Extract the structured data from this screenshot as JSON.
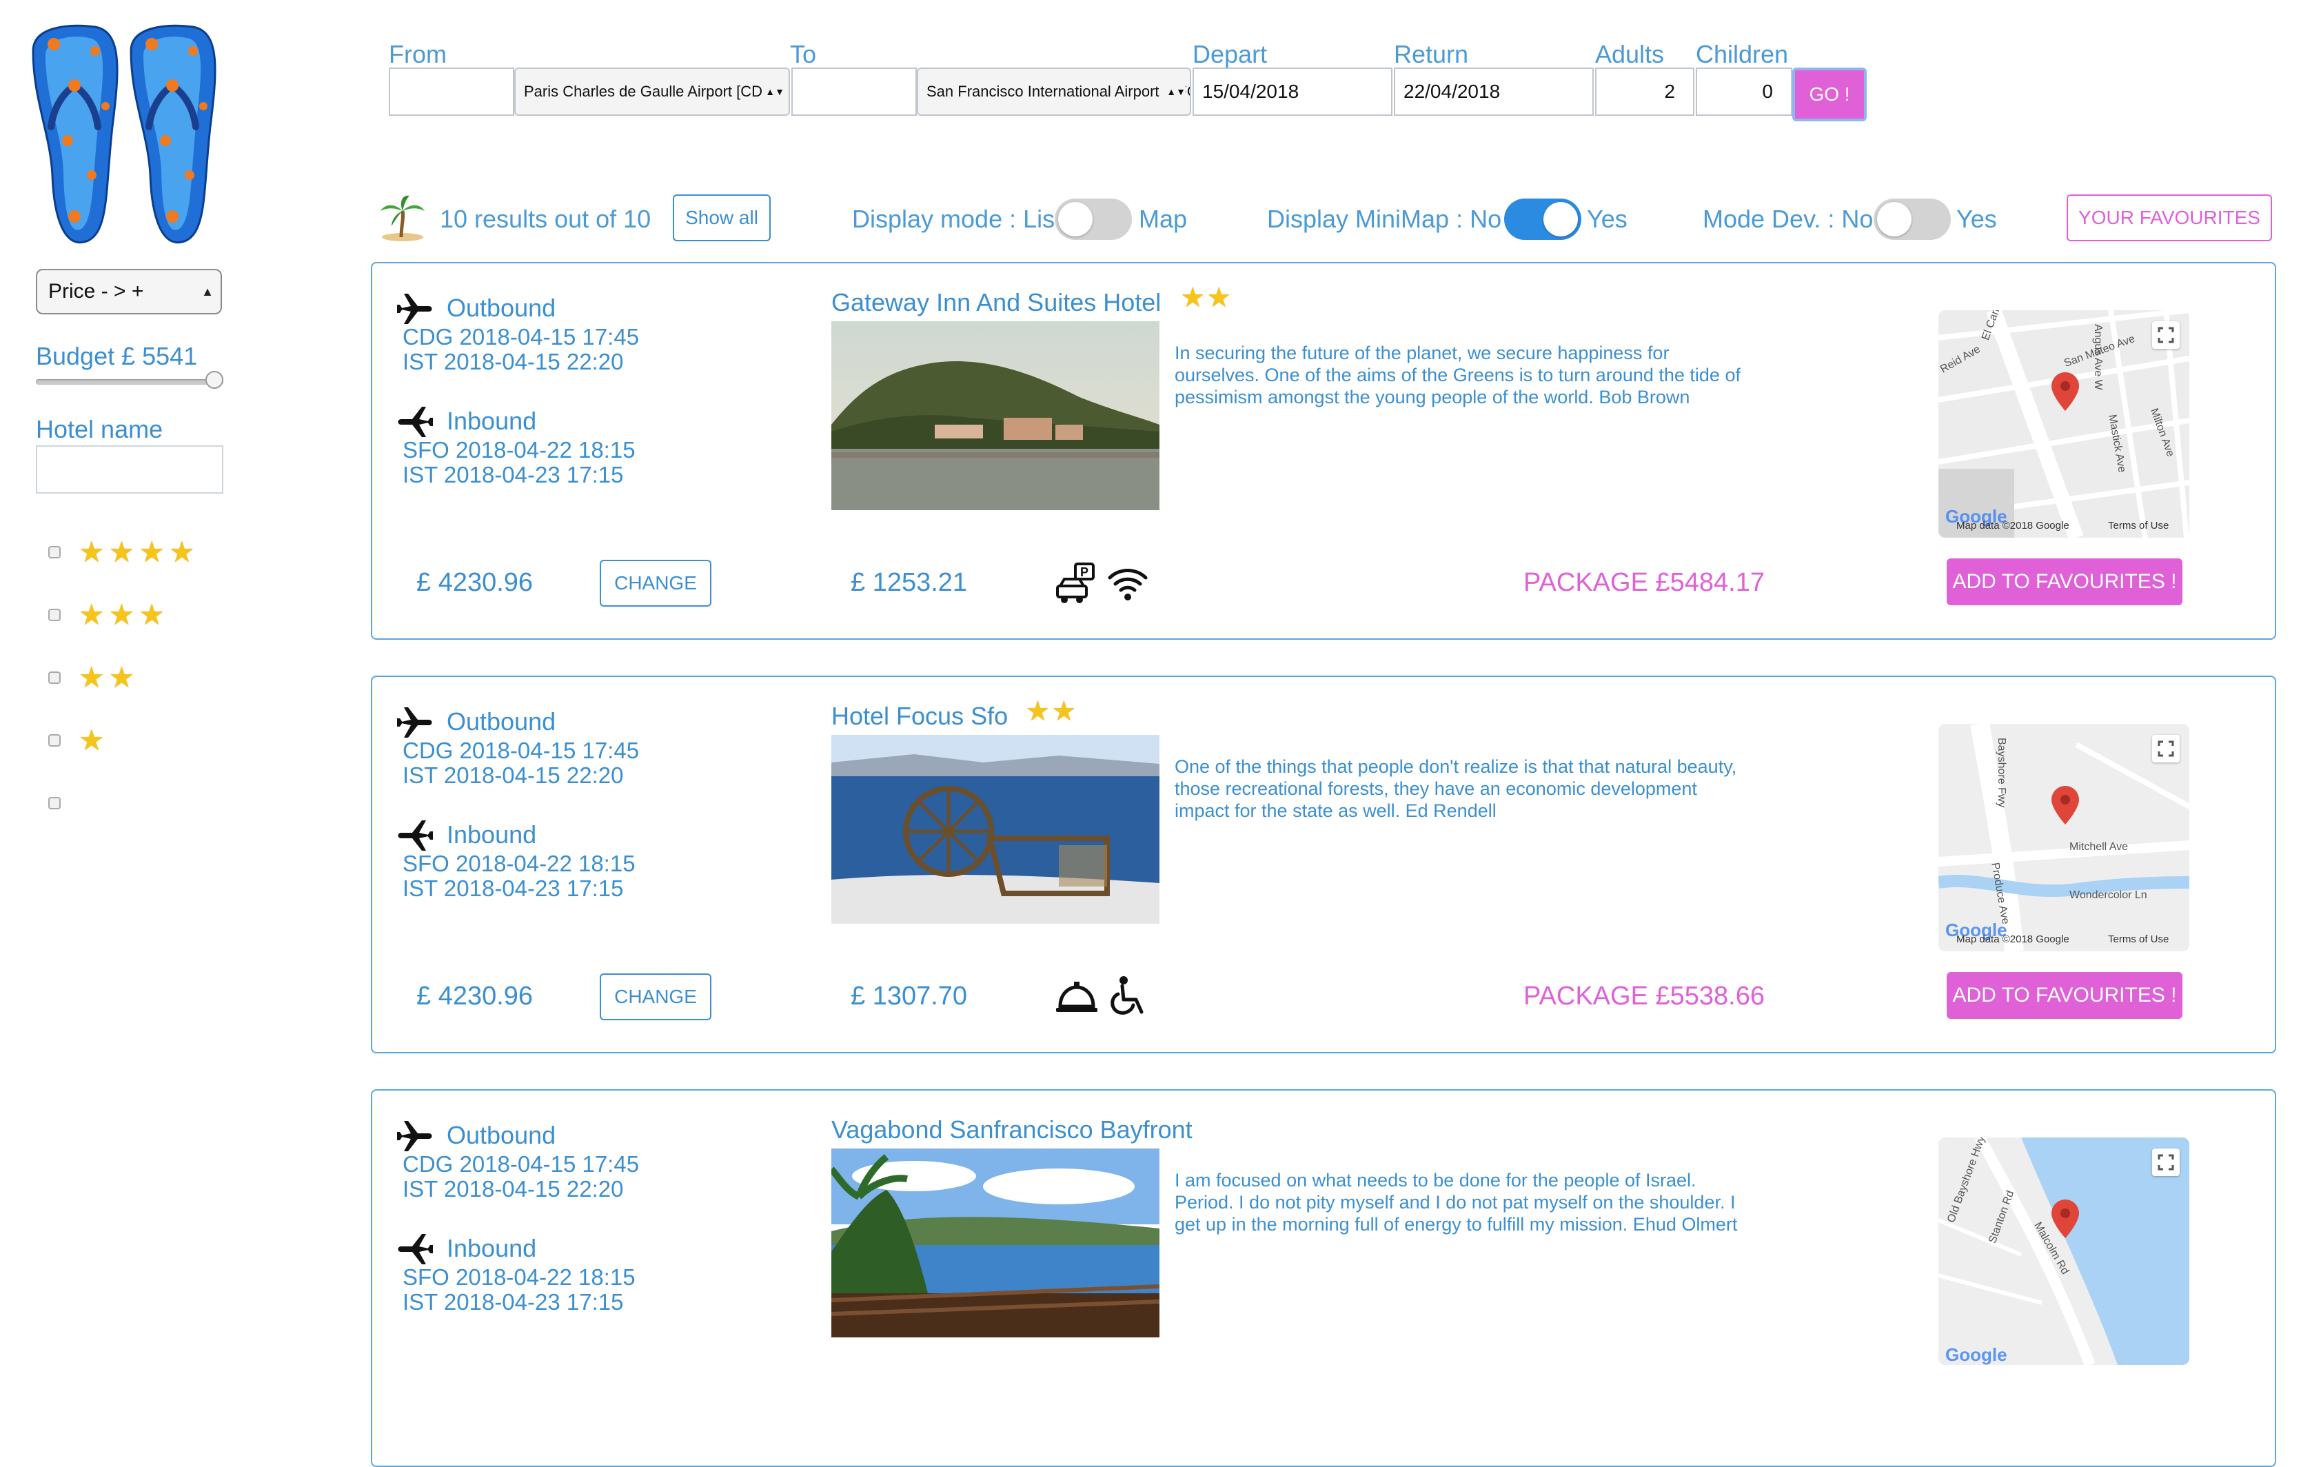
{
  "sidebar": {
    "sort_label": "Price - > +",
    "budget_label": "Budget £ 5541",
    "budget_fill": 1.0,
    "hotel_name_label": "Hotel name",
    "hotel_name_value": "",
    "star_filters": [
      {
        "stars": 4,
        "checked": false
      },
      {
        "stars": 3,
        "checked": false
      },
      {
        "stars": 2,
        "checked": false
      },
      {
        "stars": 1,
        "checked": false
      },
      {
        "stars": 0,
        "checked": false
      }
    ]
  },
  "search": {
    "from_label": "From",
    "from_value": "",
    "from_airport": "Paris Charles de Gaulle Airport [CDG]",
    "to_label": "To",
    "to_value": "",
    "to_airport": "San Francisco International Airport [SFO]",
    "depart_label": "Depart",
    "depart_value": "15/04/2018",
    "return_label": "Return",
    "return_value": "22/04/2018",
    "adults_label": "Adults",
    "adults_value": "2",
    "children_label": "Children",
    "children_value": "0",
    "go_label": "GO !"
  },
  "toolbar": {
    "results_text": "10 results out of 10",
    "show_all_label": "Show all",
    "display_mode_label": "Display mode : List",
    "display_mode_alt": "Map",
    "display_mode_on": false,
    "minimap_label": "Display MiniMap : No",
    "minimap_alt": "Yes",
    "minimap_on": true,
    "mode_dev_label": "Mode Dev. : No",
    "mode_dev_alt": "Yes",
    "mode_dev_on": false,
    "favourites_label": "YOUR FAVOURITES"
  },
  "results": [
    {
      "outbound_label": "Outbound",
      "outbound_dep": "CDG 2018-04-15 17:45",
      "outbound_arr": "IST 2018-04-15 22:20",
      "inbound_label": "Inbound",
      "inbound_dep": "SFO 2018-04-22 18:15",
      "inbound_arr": "IST 2018-04-23 17:15",
      "flight_price": "£ 4230.96",
      "change_label": "CHANGE",
      "hotel_name": "Gateway Inn And Suites Hotel",
      "hotel_stars": 2,
      "description": "In securing the future of the planet, we secure happiness for ourselves. One of the aims of the Greens is to turn around the tide of pessimism amongst the young people of the world. Bob Brown",
      "hotel_price": "£ 1253.21",
      "amenities": [
        "parking-icon",
        "wifi-icon"
      ],
      "package_label": "PACKAGE £5484.17",
      "add_fav_label": "ADD TO FAVOURITES !",
      "map_labels": [
        "El Camino Real",
        "San Mateo Ave",
        "Angus Ave W",
        "Reid Ave",
        "Mastick Ave",
        "Milton Ave"
      ],
      "map_footer": "Map data ©2018 Google",
      "map_terms": "Terms of Use"
    },
    {
      "outbound_label": "Outbound",
      "outbound_dep": "CDG 2018-04-15 17:45",
      "outbound_arr": "IST 2018-04-15 22:20",
      "inbound_label": "Inbound",
      "inbound_dep": "SFO 2018-04-22 18:15",
      "inbound_arr": "IST 2018-04-23 17:15",
      "flight_price": "£ 4230.96",
      "change_label": "CHANGE",
      "hotel_name": "Hotel Focus Sfo",
      "hotel_stars": 2,
      "description": "One of the things that people don't realize is that that natural beauty, those recreational forests, they have an economic development impact for the state as well. Ed Rendell",
      "hotel_price": "£ 1307.70",
      "amenities": [
        "room-service-icon",
        "wheelchair-icon"
      ],
      "package_label": "PACKAGE £5538.66",
      "add_fav_label": "ADD TO FAVOURITES !",
      "map_labels": [
        "Bayshore Fwy",
        "Mitchell Ave",
        "Produce Ave",
        "Wondercolor Ln"
      ],
      "map_footer": "Map data ©2018 Google",
      "map_terms": "Terms of Use"
    },
    {
      "outbound_label": "Outbound",
      "outbound_dep": "CDG 2018-04-15 17:45",
      "outbound_arr": "IST 2018-04-15 22:20",
      "inbound_label": "Inbound",
      "inbound_dep": "SFO 2018-04-22 18:15",
      "inbound_arr": "IST 2018-04-23 17:15",
      "hotel_name": "Vagabond Sanfrancisco Bayfront",
      "hotel_stars": 0,
      "description": "I am focused on what needs to be done for the people of Israel. Period. I do not pity myself and I do not pat myself on the shoulder. I get up in the morning full of energy to fulfill my mission. Ehud Olmert",
      "map_labels": [
        "Old Bayshore Hwy",
        "Malcolm Rd",
        "Stanton Rd"
      ]
    }
  ],
  "colors": {
    "accent_blue": "#3b8fd0",
    "accent_pink": "#e060d8",
    "star_gold": "#f5c518"
  }
}
